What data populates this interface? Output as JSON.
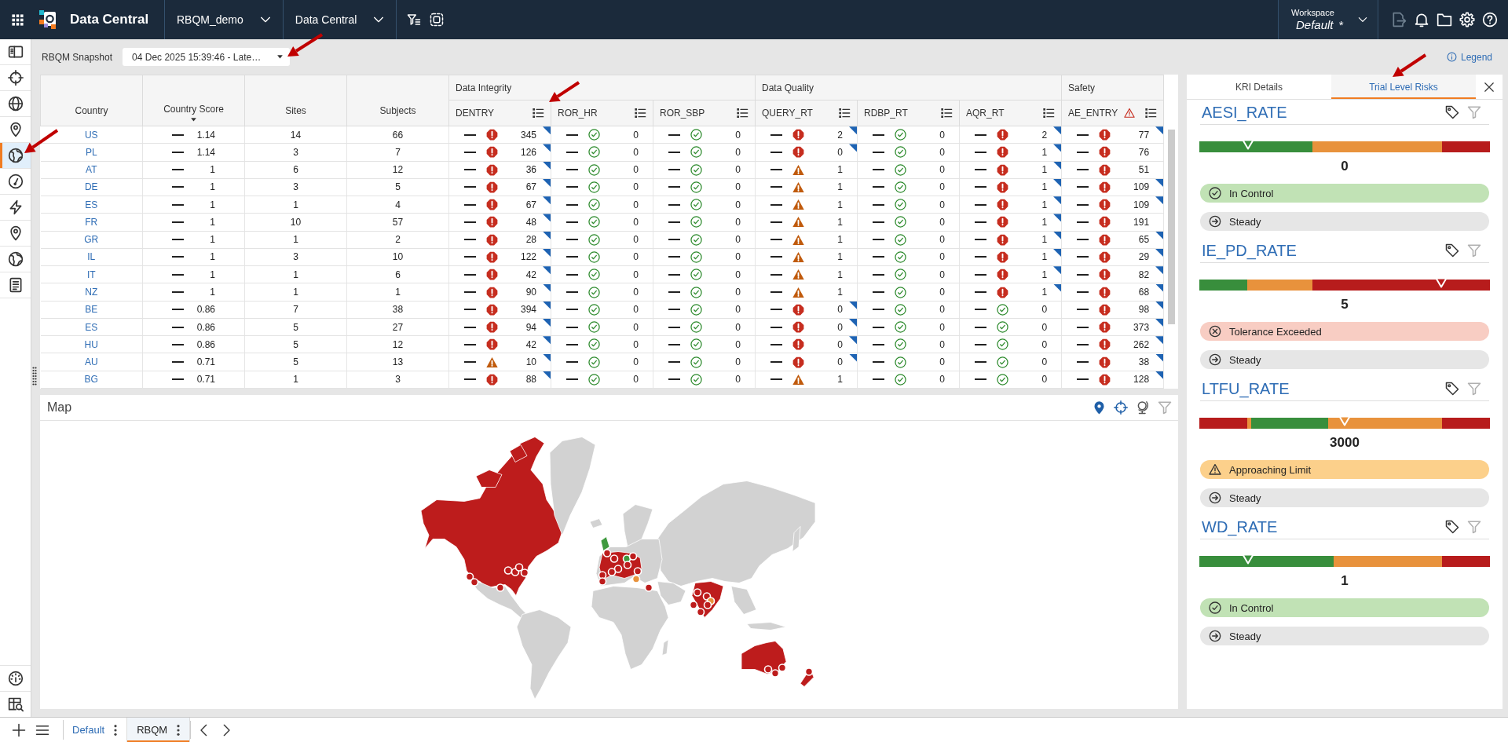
{
  "top_bar": {
    "app_title": "Data Central",
    "menus": [
      {
        "label": "RBQM_demo"
      },
      {
        "label": "Data Central"
      }
    ],
    "workspace": {
      "label": "Workspace",
      "value": "Default",
      "mark": "*"
    }
  },
  "sidebar": {
    "top_items": [
      {
        "kind": "panel",
        "selected": false
      },
      {
        "kind": "crosshair",
        "selected": false
      },
      {
        "kind": "globe",
        "selected": false
      },
      {
        "kind": "pin",
        "selected": false
      },
      {
        "kind": "earth",
        "selected": true
      },
      {
        "kind": "gauge",
        "selected": false
      },
      {
        "kind": "bolt",
        "selected": false
      },
      {
        "kind": "pin",
        "selected": false
      },
      {
        "kind": "earth",
        "selected": false
      },
      {
        "kind": "document",
        "selected": false
      }
    ],
    "bottom_items": [
      {
        "kind": "dial",
        "selected": false
      },
      {
        "kind": "table_search",
        "selected": false
      }
    ]
  },
  "snapshot": {
    "label": "RBQM Snapshot",
    "value": "04 Dec 2025 15:39:46 - Late…"
  },
  "legend": {
    "label": "Legend"
  },
  "table": {
    "columns": [
      {
        "label": "Country"
      },
      {
        "label": "Country Score",
        "sort": {
          "kind": "descending"
        }
      },
      {
        "label": "Sites"
      },
      {
        "label": "Subjects"
      }
    ],
    "groups": [
      {
        "label": "Data Integrity",
        "columns": [
          {
            "label": "DENTRY",
            "warning": false
          },
          {
            "label": "ROR_HR",
            "warning": false
          },
          {
            "label": "ROR_SBP",
            "warning": false
          }
        ]
      },
      {
        "label": "Data Quality",
        "columns": [
          {
            "label": "QUERY_RT",
            "warning": false
          },
          {
            "label": "RDBP_RT",
            "warning": false
          },
          {
            "label": "AQR_RT",
            "warning": false
          }
        ]
      },
      {
        "label": "Safety",
        "columns": [
          {
            "label": "AE_ENTRY",
            "warning": true
          }
        ]
      }
    ],
    "rows": [
      {
        "country": "US",
        "score": "1.14",
        "sites": "14",
        "subjects": "66",
        "cells": [
          {
            "kind": "alert",
            "value": "345",
            "flag": true
          },
          {
            "kind": "ok",
            "value": "0",
            "flag": false
          },
          {
            "kind": "ok",
            "value": "0",
            "flag": false
          },
          {
            "kind": "alert",
            "value": "2",
            "flag": true
          },
          {
            "kind": "ok",
            "value": "0",
            "flag": false
          },
          {
            "kind": "alert",
            "value": "2",
            "flag": true
          },
          {
            "kind": "alert",
            "value": "77",
            "flag": true
          }
        ]
      },
      {
        "country": "PL",
        "score": "1.14",
        "sites": "3",
        "subjects": "7",
        "cells": [
          {
            "kind": "alert",
            "value": "126",
            "flag": true
          },
          {
            "kind": "ok",
            "value": "0",
            "flag": false
          },
          {
            "kind": "ok",
            "value": "0",
            "flag": false
          },
          {
            "kind": "alert",
            "value": "0",
            "flag": true
          },
          {
            "kind": "ok",
            "value": "0",
            "flag": false
          },
          {
            "kind": "alert",
            "value": "1",
            "flag": true
          },
          {
            "kind": "alert",
            "value": "76",
            "flag": false
          }
        ]
      },
      {
        "country": "AT",
        "score": "1",
        "sites": "6",
        "subjects": "12",
        "cells": [
          {
            "kind": "alert",
            "value": "36",
            "flag": true
          },
          {
            "kind": "ok",
            "value": "0",
            "flag": false
          },
          {
            "kind": "ok",
            "value": "0",
            "flag": false
          },
          {
            "kind": "warning",
            "value": "1",
            "flag": false
          },
          {
            "kind": "ok",
            "value": "0",
            "flag": false
          },
          {
            "kind": "alert",
            "value": "1",
            "flag": true
          },
          {
            "kind": "alert",
            "value": "51",
            "flag": false
          }
        ]
      },
      {
        "country": "DE",
        "score": "1",
        "sites": "3",
        "subjects": "5",
        "cells": [
          {
            "kind": "alert",
            "value": "67",
            "flag": true
          },
          {
            "kind": "ok",
            "value": "0",
            "flag": false
          },
          {
            "kind": "ok",
            "value": "0",
            "flag": false
          },
          {
            "kind": "warning",
            "value": "1",
            "flag": false
          },
          {
            "kind": "ok",
            "value": "0",
            "flag": false
          },
          {
            "kind": "alert",
            "value": "1",
            "flag": true
          },
          {
            "kind": "alert",
            "value": "109",
            "flag": true
          }
        ]
      },
      {
        "country": "ES",
        "score": "1",
        "sites": "1",
        "subjects": "4",
        "cells": [
          {
            "kind": "alert",
            "value": "67",
            "flag": true
          },
          {
            "kind": "ok",
            "value": "0",
            "flag": false
          },
          {
            "kind": "ok",
            "value": "0",
            "flag": false
          },
          {
            "kind": "warning",
            "value": "1",
            "flag": false
          },
          {
            "kind": "ok",
            "value": "0",
            "flag": false
          },
          {
            "kind": "alert",
            "value": "1",
            "flag": true
          },
          {
            "kind": "alert",
            "value": "109",
            "flag": true
          }
        ]
      },
      {
        "country": "FR",
        "score": "1",
        "sites": "10",
        "subjects": "57",
        "cells": [
          {
            "kind": "alert",
            "value": "48",
            "flag": true
          },
          {
            "kind": "ok",
            "value": "0",
            "flag": false
          },
          {
            "kind": "ok",
            "value": "0",
            "flag": false
          },
          {
            "kind": "warning",
            "value": "1",
            "flag": false
          },
          {
            "kind": "ok",
            "value": "0",
            "flag": false
          },
          {
            "kind": "alert",
            "value": "1",
            "flag": true
          },
          {
            "kind": "alert",
            "value": "191",
            "flag": false
          }
        ]
      },
      {
        "country": "GR",
        "score": "1",
        "sites": "1",
        "subjects": "2",
        "cells": [
          {
            "kind": "alert",
            "value": "28",
            "flag": true
          },
          {
            "kind": "ok",
            "value": "0",
            "flag": false
          },
          {
            "kind": "ok",
            "value": "0",
            "flag": false
          },
          {
            "kind": "warning",
            "value": "1",
            "flag": false
          },
          {
            "kind": "ok",
            "value": "0",
            "flag": false
          },
          {
            "kind": "alert",
            "value": "1",
            "flag": true
          },
          {
            "kind": "alert",
            "value": "65",
            "flag": true
          }
        ]
      },
      {
        "country": "IL",
        "score": "1",
        "sites": "3",
        "subjects": "10",
        "cells": [
          {
            "kind": "alert",
            "value": "122",
            "flag": true
          },
          {
            "kind": "ok",
            "value": "0",
            "flag": false
          },
          {
            "kind": "ok",
            "value": "0",
            "flag": false
          },
          {
            "kind": "warning",
            "value": "1",
            "flag": false
          },
          {
            "kind": "ok",
            "value": "0",
            "flag": false
          },
          {
            "kind": "alert",
            "value": "1",
            "flag": true
          },
          {
            "kind": "alert",
            "value": "29",
            "flag": true
          }
        ]
      },
      {
        "country": "IT",
        "score": "1",
        "sites": "1",
        "subjects": "6",
        "cells": [
          {
            "kind": "alert",
            "value": "42",
            "flag": true
          },
          {
            "kind": "ok",
            "value": "0",
            "flag": false
          },
          {
            "kind": "ok",
            "value": "0",
            "flag": false
          },
          {
            "kind": "warning",
            "value": "1",
            "flag": false
          },
          {
            "kind": "ok",
            "value": "0",
            "flag": false
          },
          {
            "kind": "alert",
            "value": "1",
            "flag": true
          },
          {
            "kind": "alert",
            "value": "82",
            "flag": true
          }
        ]
      },
      {
        "country": "NZ",
        "score": "1",
        "sites": "1",
        "subjects": "1",
        "cells": [
          {
            "kind": "alert",
            "value": "90",
            "flag": true
          },
          {
            "kind": "ok",
            "value": "0",
            "flag": false
          },
          {
            "kind": "ok",
            "value": "0",
            "flag": false
          },
          {
            "kind": "warning",
            "value": "1",
            "flag": false
          },
          {
            "kind": "ok",
            "value": "0",
            "flag": false
          },
          {
            "kind": "alert",
            "value": "1",
            "flag": true
          },
          {
            "kind": "alert",
            "value": "68",
            "flag": true
          }
        ]
      },
      {
        "country": "BE",
        "score": "0.86",
        "sites": "7",
        "subjects": "38",
        "cells": [
          {
            "kind": "alert",
            "value": "394",
            "flag": true
          },
          {
            "kind": "ok",
            "value": "0",
            "flag": false
          },
          {
            "kind": "ok",
            "value": "0",
            "flag": false
          },
          {
            "kind": "alert",
            "value": "0",
            "flag": true
          },
          {
            "kind": "ok",
            "value": "0",
            "flag": false
          },
          {
            "kind": "ok",
            "value": "0",
            "flag": false
          },
          {
            "kind": "alert",
            "value": "98",
            "flag": true
          }
        ]
      },
      {
        "country": "ES",
        "score": "0.86",
        "sites": "5",
        "subjects": "27",
        "cells": [
          {
            "kind": "alert",
            "value": "94",
            "flag": true
          },
          {
            "kind": "ok",
            "value": "0",
            "flag": false
          },
          {
            "kind": "ok",
            "value": "0",
            "flag": false
          },
          {
            "kind": "alert",
            "value": "0",
            "flag": true
          },
          {
            "kind": "ok",
            "value": "0",
            "flag": false
          },
          {
            "kind": "ok",
            "value": "0",
            "flag": false
          },
          {
            "kind": "alert",
            "value": "373",
            "flag": true
          }
        ]
      },
      {
        "country": "HU",
        "score": "0.86",
        "sites": "5",
        "subjects": "12",
        "cells": [
          {
            "kind": "alert",
            "value": "42",
            "flag": true
          },
          {
            "kind": "ok",
            "value": "0",
            "flag": false
          },
          {
            "kind": "ok",
            "value": "0",
            "flag": false
          },
          {
            "kind": "alert",
            "value": "0",
            "flag": true
          },
          {
            "kind": "ok",
            "value": "0",
            "flag": false
          },
          {
            "kind": "ok",
            "value": "0",
            "flag": false
          },
          {
            "kind": "alert",
            "value": "262",
            "flag": true
          }
        ]
      },
      {
        "country": "AU",
        "score": "0.71",
        "sites": "5",
        "subjects": "13",
        "cells": [
          {
            "kind": "warning",
            "value": "10",
            "flag": true
          },
          {
            "kind": "ok",
            "value": "0",
            "flag": false
          },
          {
            "kind": "ok",
            "value": "0",
            "flag": false
          },
          {
            "kind": "alert",
            "value": "0",
            "flag": true
          },
          {
            "kind": "ok",
            "value": "0",
            "flag": false
          },
          {
            "kind": "ok",
            "value": "0",
            "flag": false
          },
          {
            "kind": "alert",
            "value": "38",
            "flag": true
          }
        ]
      },
      {
        "country": "BG",
        "score": "0.71",
        "sites": "1",
        "subjects": "3",
        "cells": [
          {
            "kind": "alert",
            "value": "88",
            "flag": true
          },
          {
            "kind": "ok",
            "value": "0",
            "flag": false
          },
          {
            "kind": "ok",
            "value": "0",
            "flag": false
          },
          {
            "kind": "warning",
            "value": "1",
            "flag": false
          },
          {
            "kind": "ok",
            "value": "0",
            "flag": false
          },
          {
            "kind": "ok",
            "value": "0",
            "flag": false
          },
          {
            "kind": "alert",
            "value": "128",
            "flag": true
          }
        ]
      }
    ]
  },
  "map": {
    "title": "Map"
  },
  "kri_panel": {
    "tabs": [
      {
        "label": "KRI Details",
        "selected": false
      },
      {
        "label": "Trial Level Risks",
        "selected": true
      }
    ],
    "cards": [
      {
        "name": "AESI_RATE",
        "bands": [
          {
            "kind": "sized",
            "color": "#388e3c",
            "level": 0.389
          },
          {
            "kind": "rest",
            "color": "#e8923c"
          },
          {
            "kind": "sized",
            "color": "#b71c1c",
            "level": 0.166
          }
        ],
        "level": 0.167,
        "value": "0",
        "status": {
          "kind": "in_control",
          "label": "In Control"
        },
        "trend": {
          "kind": "steady",
          "label": "Steady"
        }
      },
      {
        "name": "IE_PD_RATE",
        "bands": [
          {
            "kind": "sized",
            "color": "#388e3c",
            "level": 0.165
          },
          {
            "kind": "rest",
            "color": "#e8923c"
          },
          {
            "kind": "sized",
            "color": "#b71c1c",
            "level": 0.611
          }
        ],
        "level": 0.833,
        "value": "5",
        "status": {
          "kind": "tolerance_exceeded",
          "label": "Tolerance Exceeded"
        },
        "trend": {
          "kind": "steady",
          "label": "Steady"
        }
      },
      {
        "name": "LTFU_RATE",
        "bands": [
          {
            "kind": "sized",
            "color": "#b71c1c",
            "level": 0.165
          },
          {
            "kind": "sized",
            "color": "#e8923c",
            "level": 0.013
          },
          {
            "kind": "sized",
            "color": "#388e3c",
            "level": 0.265
          },
          {
            "kind": "rest",
            "color": "#e8923c"
          },
          {
            "kind": "sized",
            "color": "#b71c1c",
            "level": 0.166
          }
        ],
        "level": 0.5,
        "value": "3000",
        "status": {
          "kind": "approaching_limit",
          "label": "Approaching Limit"
        },
        "trend": {
          "kind": "steady",
          "label": "Steady"
        }
      },
      {
        "name": "WD_RATE",
        "bands": [
          {
            "kind": "sized",
            "color": "#388e3c",
            "level": 0.462
          },
          {
            "kind": "rest",
            "color": "#e8923c"
          },
          {
            "kind": "sized",
            "color": "#b71c1c",
            "level": 0.166
          }
        ],
        "level": 0.167,
        "value": "1",
        "status": {
          "kind": "in_control",
          "label": "In Control"
        },
        "trend": {
          "kind": "steady",
          "label": "Steady"
        }
      }
    ]
  },
  "bottom_bar": {
    "tabs": [
      {
        "label": "Default",
        "selected": false
      },
      {
        "label": "RBQM",
        "selected": true
      }
    ]
  }
}
